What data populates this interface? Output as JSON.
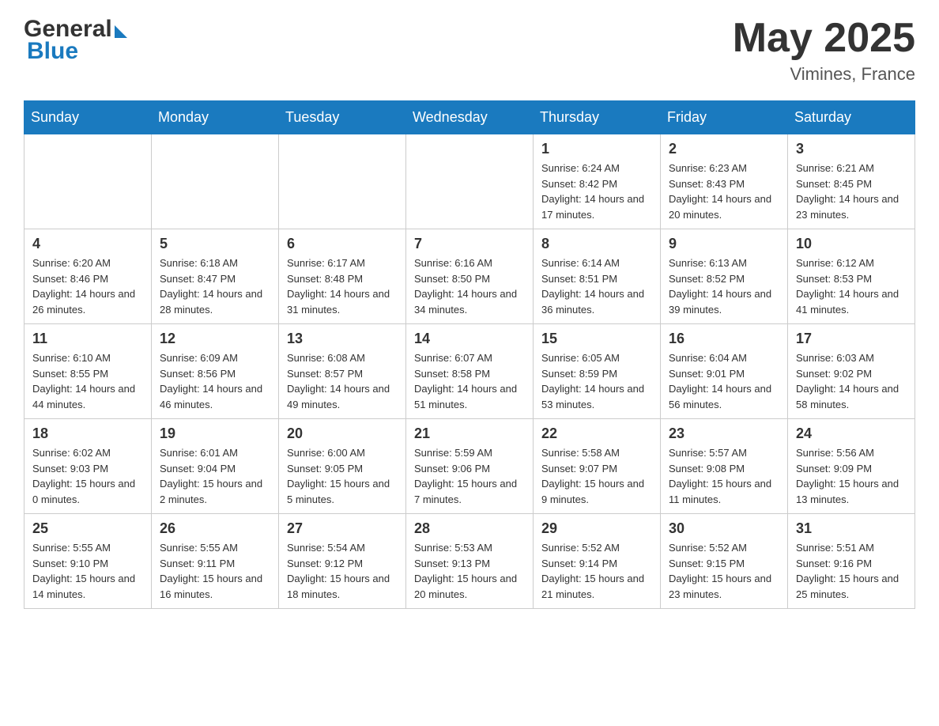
{
  "header": {
    "logo_general": "General",
    "logo_blue": "Blue",
    "month_title": "May 2025",
    "location": "Vimines, France"
  },
  "days_of_week": [
    "Sunday",
    "Monday",
    "Tuesday",
    "Wednesday",
    "Thursday",
    "Friday",
    "Saturday"
  ],
  "weeks": [
    [
      {
        "day": "",
        "info": ""
      },
      {
        "day": "",
        "info": ""
      },
      {
        "day": "",
        "info": ""
      },
      {
        "day": "",
        "info": ""
      },
      {
        "day": "1",
        "info": "Sunrise: 6:24 AM\nSunset: 8:42 PM\nDaylight: 14 hours and 17 minutes."
      },
      {
        "day": "2",
        "info": "Sunrise: 6:23 AM\nSunset: 8:43 PM\nDaylight: 14 hours and 20 minutes."
      },
      {
        "day": "3",
        "info": "Sunrise: 6:21 AM\nSunset: 8:45 PM\nDaylight: 14 hours and 23 minutes."
      }
    ],
    [
      {
        "day": "4",
        "info": "Sunrise: 6:20 AM\nSunset: 8:46 PM\nDaylight: 14 hours and 26 minutes."
      },
      {
        "day": "5",
        "info": "Sunrise: 6:18 AM\nSunset: 8:47 PM\nDaylight: 14 hours and 28 minutes."
      },
      {
        "day": "6",
        "info": "Sunrise: 6:17 AM\nSunset: 8:48 PM\nDaylight: 14 hours and 31 minutes."
      },
      {
        "day": "7",
        "info": "Sunrise: 6:16 AM\nSunset: 8:50 PM\nDaylight: 14 hours and 34 minutes."
      },
      {
        "day": "8",
        "info": "Sunrise: 6:14 AM\nSunset: 8:51 PM\nDaylight: 14 hours and 36 minutes."
      },
      {
        "day": "9",
        "info": "Sunrise: 6:13 AM\nSunset: 8:52 PM\nDaylight: 14 hours and 39 minutes."
      },
      {
        "day": "10",
        "info": "Sunrise: 6:12 AM\nSunset: 8:53 PM\nDaylight: 14 hours and 41 minutes."
      }
    ],
    [
      {
        "day": "11",
        "info": "Sunrise: 6:10 AM\nSunset: 8:55 PM\nDaylight: 14 hours and 44 minutes."
      },
      {
        "day": "12",
        "info": "Sunrise: 6:09 AM\nSunset: 8:56 PM\nDaylight: 14 hours and 46 minutes."
      },
      {
        "day": "13",
        "info": "Sunrise: 6:08 AM\nSunset: 8:57 PM\nDaylight: 14 hours and 49 minutes."
      },
      {
        "day": "14",
        "info": "Sunrise: 6:07 AM\nSunset: 8:58 PM\nDaylight: 14 hours and 51 minutes."
      },
      {
        "day": "15",
        "info": "Sunrise: 6:05 AM\nSunset: 8:59 PM\nDaylight: 14 hours and 53 minutes."
      },
      {
        "day": "16",
        "info": "Sunrise: 6:04 AM\nSunset: 9:01 PM\nDaylight: 14 hours and 56 minutes."
      },
      {
        "day": "17",
        "info": "Sunrise: 6:03 AM\nSunset: 9:02 PM\nDaylight: 14 hours and 58 minutes."
      }
    ],
    [
      {
        "day": "18",
        "info": "Sunrise: 6:02 AM\nSunset: 9:03 PM\nDaylight: 15 hours and 0 minutes."
      },
      {
        "day": "19",
        "info": "Sunrise: 6:01 AM\nSunset: 9:04 PM\nDaylight: 15 hours and 2 minutes."
      },
      {
        "day": "20",
        "info": "Sunrise: 6:00 AM\nSunset: 9:05 PM\nDaylight: 15 hours and 5 minutes."
      },
      {
        "day": "21",
        "info": "Sunrise: 5:59 AM\nSunset: 9:06 PM\nDaylight: 15 hours and 7 minutes."
      },
      {
        "day": "22",
        "info": "Sunrise: 5:58 AM\nSunset: 9:07 PM\nDaylight: 15 hours and 9 minutes."
      },
      {
        "day": "23",
        "info": "Sunrise: 5:57 AM\nSunset: 9:08 PM\nDaylight: 15 hours and 11 minutes."
      },
      {
        "day": "24",
        "info": "Sunrise: 5:56 AM\nSunset: 9:09 PM\nDaylight: 15 hours and 13 minutes."
      }
    ],
    [
      {
        "day": "25",
        "info": "Sunrise: 5:55 AM\nSunset: 9:10 PM\nDaylight: 15 hours and 14 minutes."
      },
      {
        "day": "26",
        "info": "Sunrise: 5:55 AM\nSunset: 9:11 PM\nDaylight: 15 hours and 16 minutes."
      },
      {
        "day": "27",
        "info": "Sunrise: 5:54 AM\nSunset: 9:12 PM\nDaylight: 15 hours and 18 minutes."
      },
      {
        "day": "28",
        "info": "Sunrise: 5:53 AM\nSunset: 9:13 PM\nDaylight: 15 hours and 20 minutes."
      },
      {
        "day": "29",
        "info": "Sunrise: 5:52 AM\nSunset: 9:14 PM\nDaylight: 15 hours and 21 minutes."
      },
      {
        "day": "30",
        "info": "Sunrise: 5:52 AM\nSunset: 9:15 PM\nDaylight: 15 hours and 23 minutes."
      },
      {
        "day": "31",
        "info": "Sunrise: 5:51 AM\nSunset: 9:16 PM\nDaylight: 15 hours and 25 minutes."
      }
    ]
  ]
}
